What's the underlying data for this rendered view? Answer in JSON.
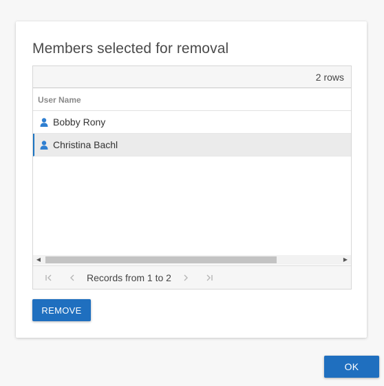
{
  "dialog": {
    "title": "Members selected for removal",
    "grid": {
      "row_count": "2 rows",
      "column_header": "User Name",
      "rows": [
        {
          "name": "Bobby Rony",
          "selected": false
        },
        {
          "name": "Christina Bachl",
          "selected": true
        }
      ],
      "pager": {
        "records_text": "Records from 1 to 2",
        "first_icon": "first-page-icon",
        "prev_icon": "previous-page-icon",
        "next_icon": "next-page-icon",
        "last_icon": "last-page-icon"
      }
    },
    "remove_label": "REMOVE"
  },
  "footer": {
    "ok_label": "OK"
  },
  "colors": {
    "accent": "#1f6fbf",
    "user_icon": "#2f7fd1",
    "selected_row": "#ebebeb",
    "background": "#f7f7f7"
  },
  "icons": {
    "row_icon": "user-icon"
  }
}
